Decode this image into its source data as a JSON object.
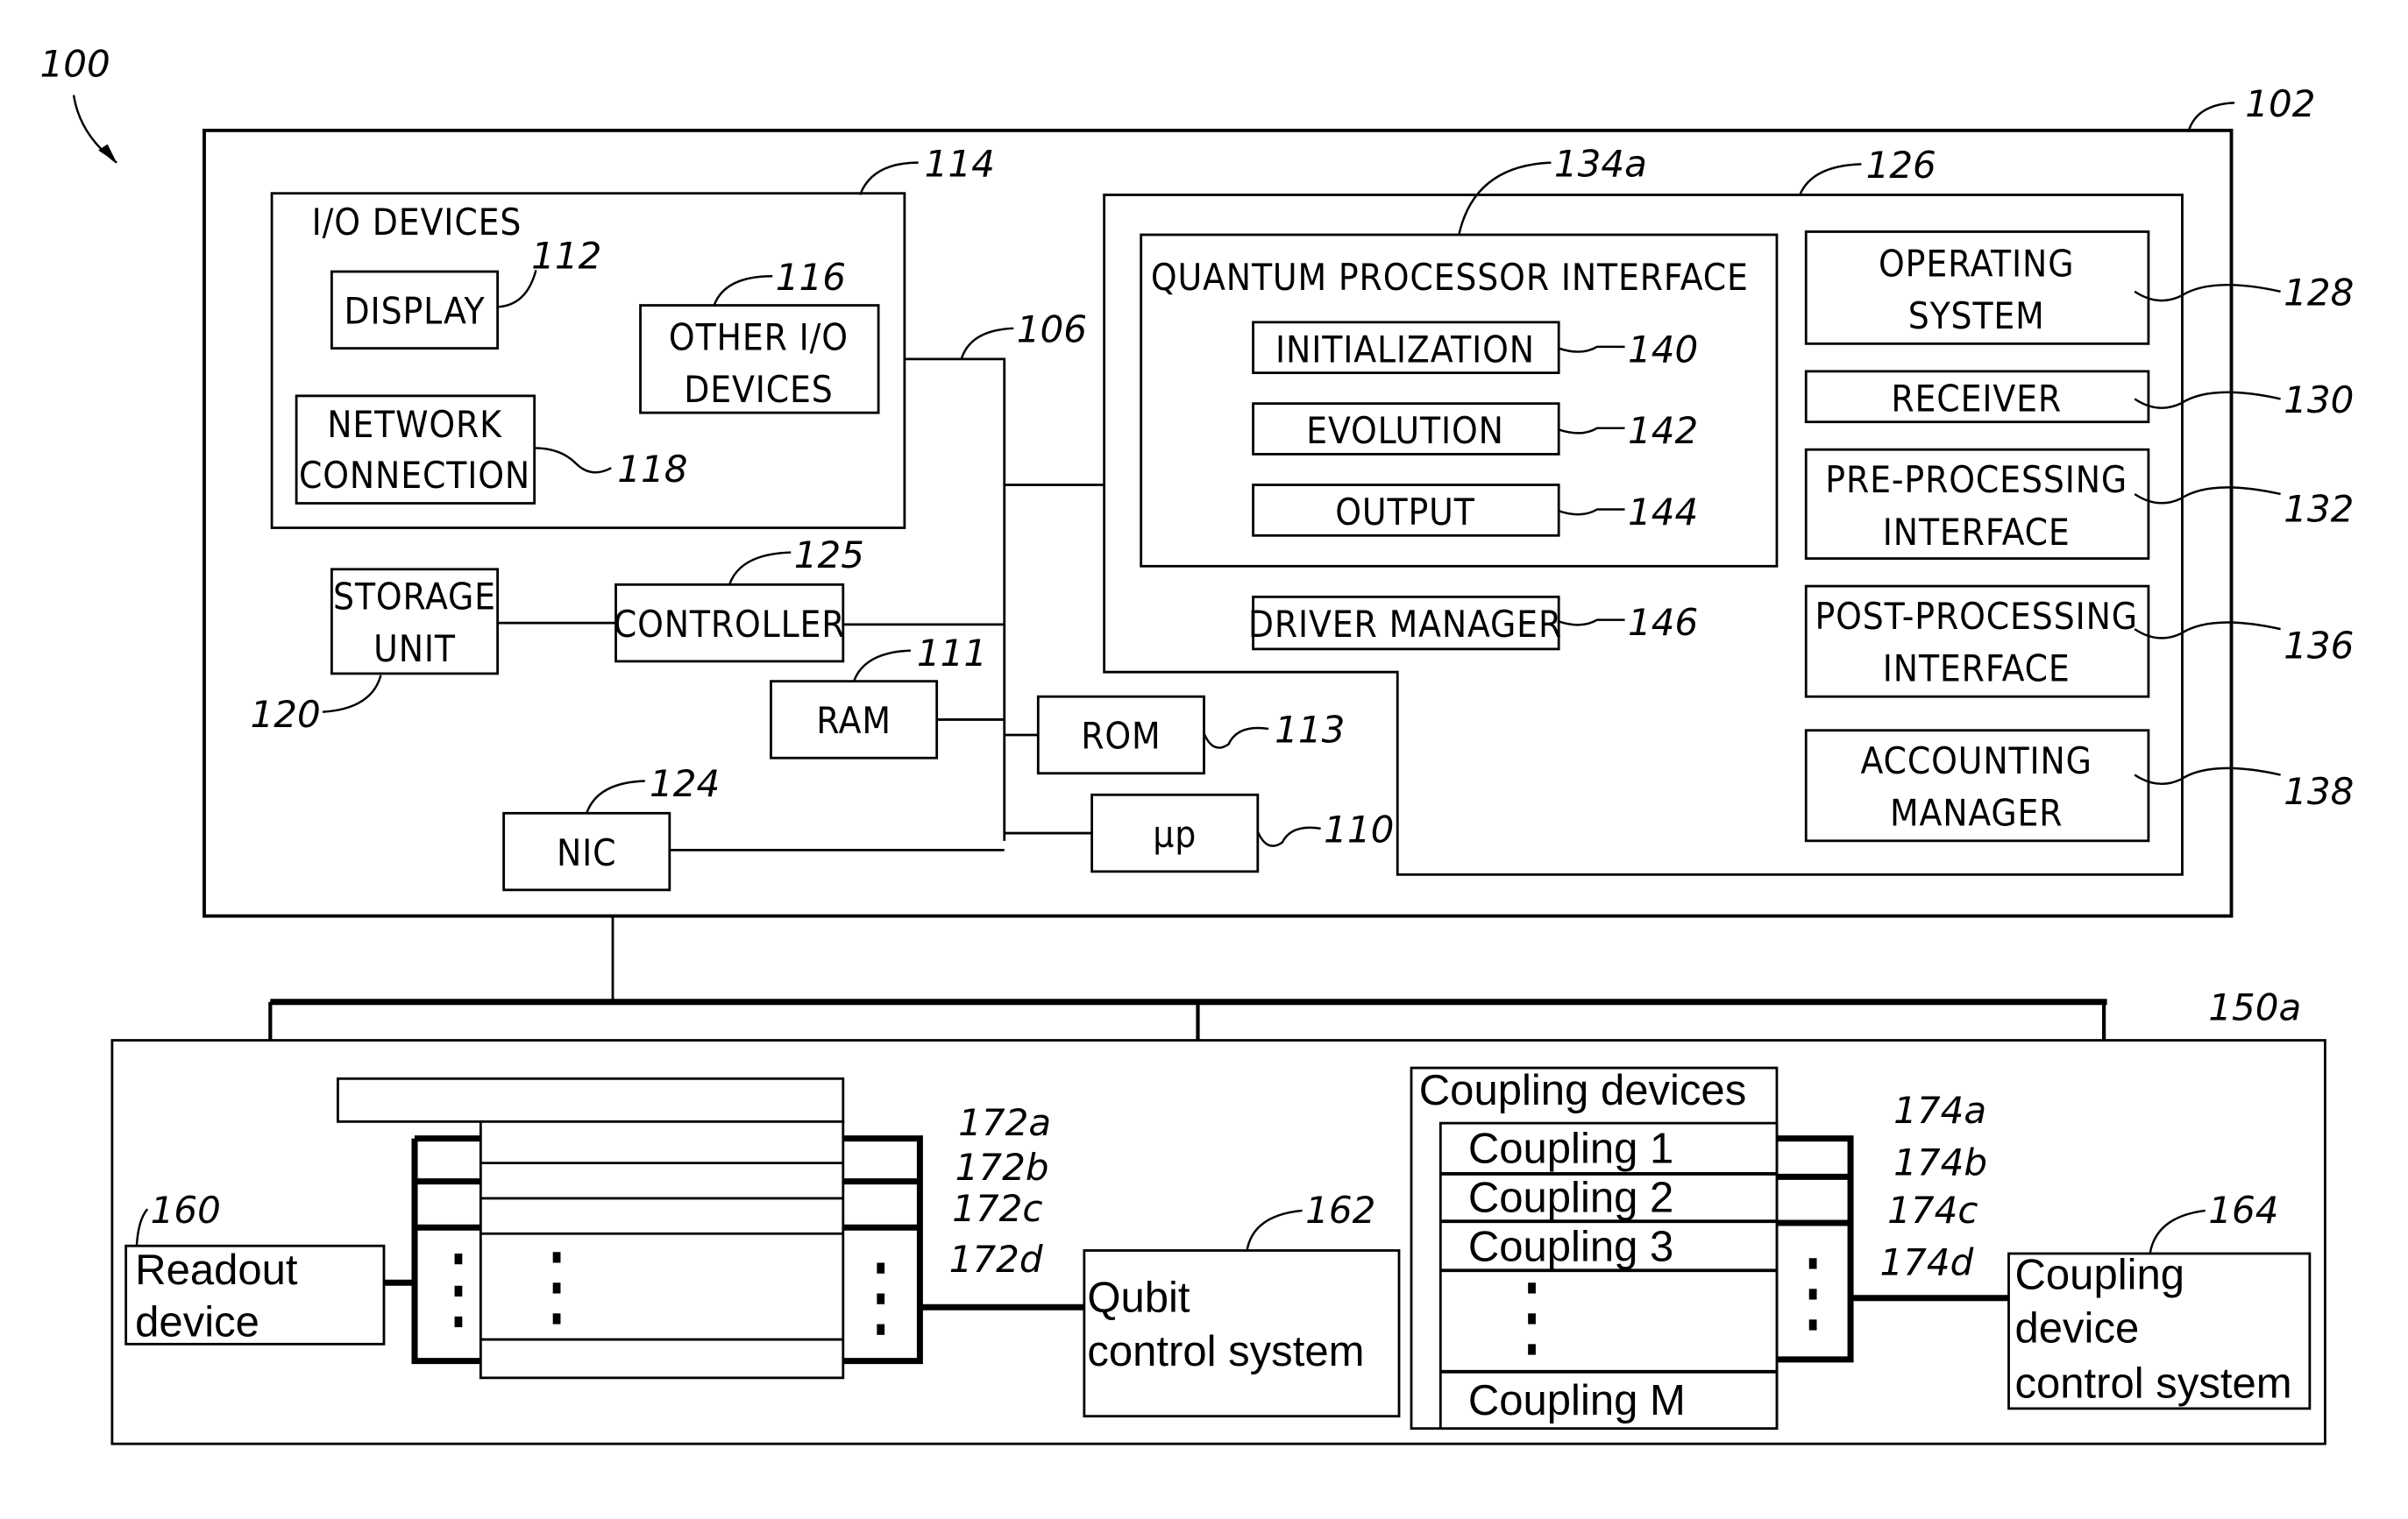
{
  "figure": {
    "ref": "100",
    "computer_system": {
      "ref": "102",
      "io_devices": {
        "ref": "114",
        "title": "I/O DEVICES",
        "display": {
          "label": "DISPLAY",
          "ref": "112"
        },
        "other_io": {
          "line1": "OTHER I/O",
          "line2": "DEVICES",
          "ref": "116"
        },
        "network_connection": {
          "line1": "NETWORK",
          "line2": "CONNECTION",
          "ref": "118"
        }
      },
      "bus_ref": "106",
      "storage_unit": {
        "line1": "STORAGE",
        "line2": "UNIT",
        "ref": "120"
      },
      "controller": {
        "label": "CONTROLLER",
        "ref": "125"
      },
      "ram": {
        "label": "RAM",
        "ref": "111"
      },
      "rom": {
        "label": "ROM",
        "ref": "113"
      },
      "nic": {
        "label": "NIC",
        "ref": "124"
      },
      "microprocessor": {
        "label": "µp",
        "ref": "110"
      },
      "memory": {
        "ref": "126",
        "quantum_processor_interface": {
          "ref": "134a",
          "title": "QUANTUM PROCESSOR INTERFACE",
          "modules": [
            {
              "label": "INITIALIZATION",
              "ref": "140"
            },
            {
              "label": "EVOLUTION",
              "ref": "142"
            },
            {
              "label": "OUTPUT",
              "ref": "144"
            }
          ]
        },
        "driver_manager": {
          "label": "DRIVER MANAGER",
          "ref": "146"
        },
        "right_modules": [
          {
            "line1": "OPERATING",
            "line2": "SYSTEM",
            "ref": "128"
          },
          {
            "line1": "RECEIVER",
            "line2": "",
            "ref": "130"
          },
          {
            "line1": "PRE-PROCESSING",
            "line2": "INTERFACE",
            "ref": "132"
          },
          {
            "line1": "POST-PROCESSING",
            "line2": "INTERFACE",
            "ref": "136"
          },
          {
            "line1": "ACCOUNTING",
            "line2": "MANAGER",
            "ref": "138"
          }
        ]
      }
    },
    "quantum_processor_system": {
      "ref": "150a",
      "readout_device": {
        "line1": "Readout",
        "line2": "device",
        "ref": "160"
      },
      "qubit_control": {
        "line1": "Qubit",
        "line2": "control system",
        "ref": "162"
      },
      "coupling_control": {
        "line1": "Coupling",
        "line2": "device",
        "line3": "control system",
        "ref": "164"
      },
      "qubit_lines": [
        "172a",
        "172b",
        "172c",
        "172d"
      ],
      "coupling_devices": {
        "title": "Coupling devices",
        "items": [
          "Coupling 1",
          "Coupling 2",
          "Coupling 3",
          "Coupling M"
        ]
      },
      "coupling_lines": [
        "174a",
        "174b",
        "174c",
        "174d"
      ]
    }
  }
}
